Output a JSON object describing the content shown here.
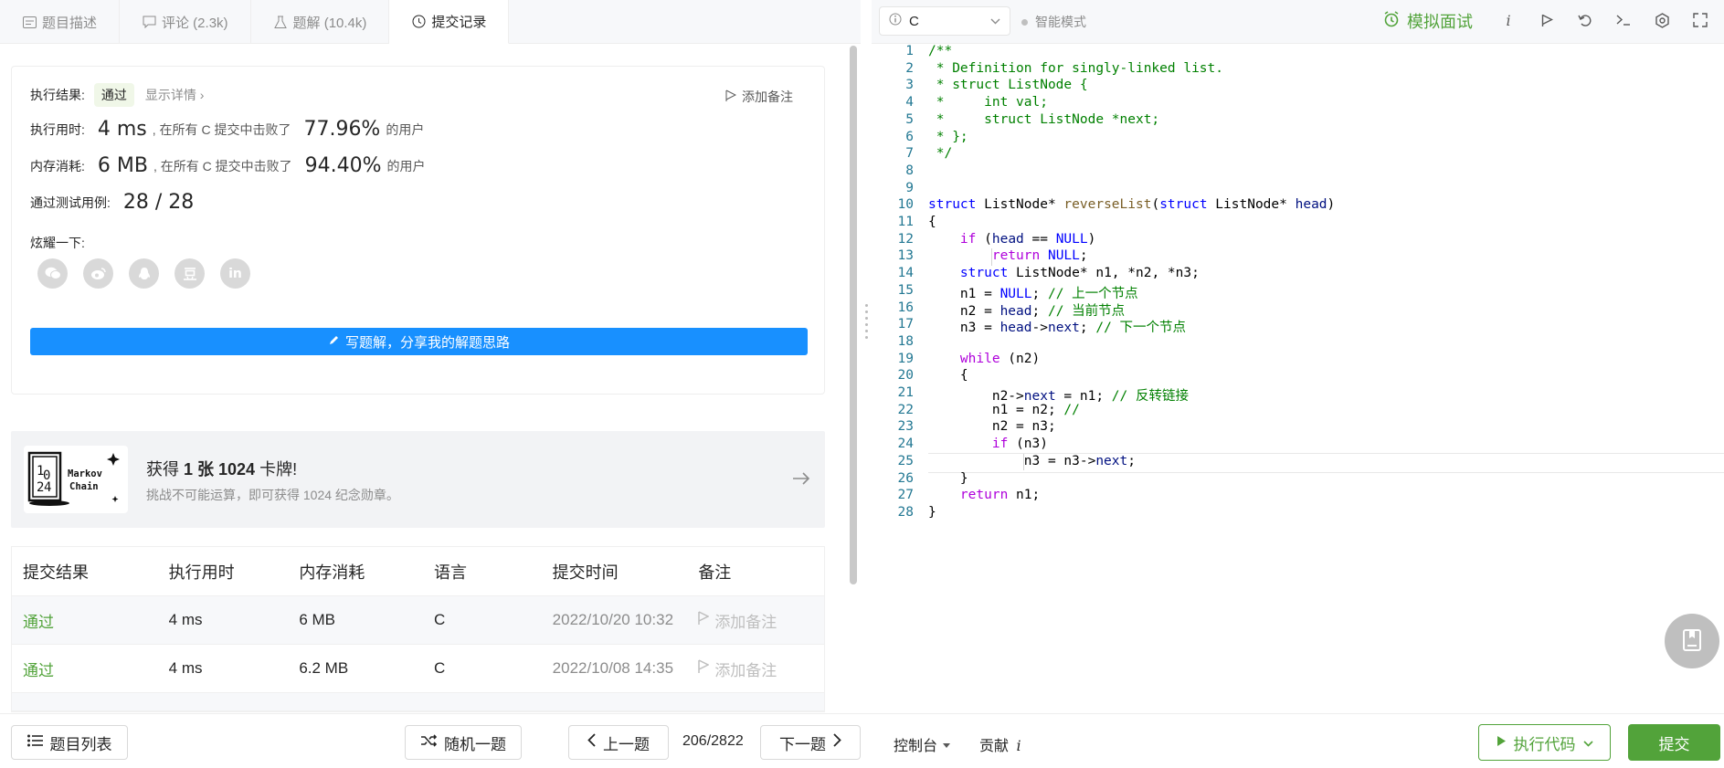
{
  "tabs": [
    {
      "label": "题目描述",
      "icon": "doc-icon"
    },
    {
      "label": "评论 (2.3k)",
      "icon": "comment-icon"
    },
    {
      "label": "题解 (10.4k)",
      "icon": "flask-icon"
    },
    {
      "label": "提交记录",
      "icon": "clock-icon"
    }
  ],
  "result": {
    "exec_result_label": "执行结果:",
    "status": "通过",
    "detail_link": "显示详情",
    "add_note": "添加备注",
    "time_label": "执行用时:",
    "time_value": "4 ms",
    "time_beat_text": ", 在所有 C 提交中击败了",
    "time_pct": "77.96%",
    "users_text": "的用户",
    "mem_label": "内存消耗:",
    "mem_value": "6 MB",
    "mem_beat_text": ", 在所有 C 提交中击败了",
    "mem_pct": "94.40%",
    "cases_label": "通过测试用例:",
    "cases_value": "28 / 28",
    "share_label": "炫耀一下:",
    "write_btn": "写题解，分享我的解题思路"
  },
  "share_icons": [
    "wechat-icon",
    "weibo-icon",
    "qq-icon",
    "douban-icon",
    "linkedin-icon"
  ],
  "badge": {
    "title_prefix": "获得 ",
    "title_bold": "1 张 1024",
    "title_suffix": " 卡牌!",
    "subtitle": "挑战不可能运算，即可获得 1024 纪念勋章。",
    "img_text": "Markov Chain"
  },
  "table": {
    "headers": [
      "提交结果",
      "执行用时",
      "内存消耗",
      "语言",
      "提交时间",
      "备注"
    ],
    "rows": [
      {
        "result": "通过",
        "time": "4 ms",
        "mem": "6 MB",
        "lang": "C",
        "date": "2022/10/20 10:32",
        "note": "添加备注"
      },
      {
        "result": "通过",
        "time": "4 ms",
        "mem": "6.2 MB",
        "lang": "C",
        "date": "2022/10/08 14:35",
        "note": "添加备注"
      }
    ]
  },
  "editor": {
    "language": "C",
    "smart_mode": "智能模式",
    "mock_interview": "模拟面试",
    "current_line": 25
  },
  "code_lines": [
    "/**",
    " * Definition for singly-linked list.",
    " * struct ListNode {",
    " *     int val;",
    " *     struct ListNode *next;",
    " * };",
    " */",
    "",
    "",
    "struct ListNode* reverseList(struct ListNode* head)",
    "{",
    "    if (head == NULL)",
    "        return NULL;",
    "    struct ListNode* n1, *n2, *n3;",
    "    n1 = NULL; // 上一个节点",
    "    n2 = head; // 当前节点",
    "    n3 = head->next; // 下一个节点",
    "",
    "    while (n2)",
    "    {",
    "        n2->next = n1; // 反转链接",
    "        n1 = n2; //",
    "        n2 = n3;",
    "        if (n3)",
    "            n3 = n3->next;",
    "    }",
    "    return n1;",
    "}"
  ],
  "bottom": {
    "problem_list": "题目列表",
    "random": "随机一题",
    "prev": "上一题",
    "pager": "206/2822",
    "next": "下一题",
    "console": "控制台",
    "contribute": "贡献",
    "run": "执行代码",
    "submit": "提交"
  },
  "colors": {
    "accent_green": "#52a33a",
    "primary_blue": "#1890ff"
  }
}
